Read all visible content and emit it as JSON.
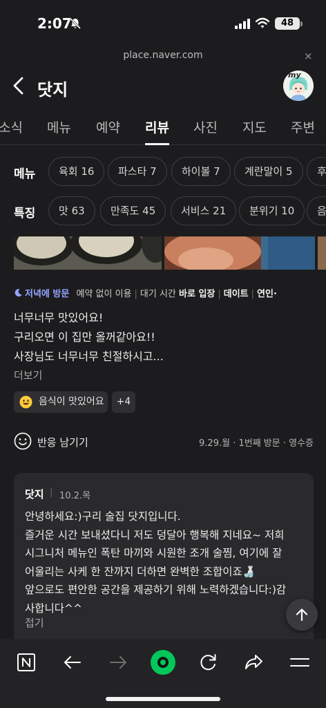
{
  "status_bar": {
    "time": "2:07",
    "battery": "48"
  },
  "browser": {
    "url": "place.naver.com",
    "close_label": "×"
  },
  "header": {
    "title": "닷지"
  },
  "tabs": [
    {
      "label": "소식"
    },
    {
      "label": "메뉴"
    },
    {
      "label": "예약"
    },
    {
      "label": "리뷰",
      "active": true
    },
    {
      "label": "사진"
    },
    {
      "label": "지도"
    },
    {
      "label": "주변"
    }
  ],
  "menu_filter": {
    "label": "메뉴",
    "chips": [
      "육회 16",
      "파스타 7",
      "하이볼 7",
      "계란말이 5",
      "후"
    ]
  },
  "feature_filter": {
    "label": "특징",
    "chips": [
      "맛 63",
      "만족도 45",
      "서비스 21",
      "분위기 10",
      "음"
    ]
  },
  "review": {
    "visit_time": "저녁에 방문",
    "meta": [
      {
        "pre": "예약 없이 이용"
      },
      {
        "pre": "대기 시간 ",
        "bold": "바로 입장"
      },
      {
        "bold": "데이트"
      },
      {
        "bold": "연인·"
      }
    ],
    "text_lines": [
      "너무너무 맛있어요!",
      "구리오면 이 집만 올꺼같아요!!",
      "사장님도 너무너무 친절하시고..."
    ],
    "more_label": "더보기",
    "tag_label": "음식이 맛있어요",
    "tag_more": "+4",
    "react_label": "반응 남기기",
    "visit_info": "9.29.월 · 1번째 방문 · 영수증"
  },
  "reply": {
    "owner": "닷지",
    "separator": "|",
    "date": "10.2.목",
    "text_lines": [
      "안녕하세요:)구리 술집 닷지입니다.",
      "즐거운 시간 보내셨다니 저도 덩달아 행복해 지네요~ 저희",
      "시그니처 메뉴인 폭탄 마끼와 시원한 조개 술찜, 여기에 잘",
      "어울리는 사케 한 잔까지 더하면 완벽한 조합이죠🍶",
      "앞으로도 편안한 공간을 제공하기 위해 노력하겠습니다:)감",
      "사합니다^^"
    ],
    "fold_label": "접기"
  },
  "bottom_nav": [
    "naver-home-icon",
    "back-arrow-icon",
    "forward-arrow-icon",
    "green-dot-icon",
    "reload-icon",
    "share-icon",
    "menu-icon"
  ],
  "colors": {
    "background": "#1c1c1e",
    "accent_green": "#03c75a",
    "visit_blue": "#93a3ff"
  }
}
